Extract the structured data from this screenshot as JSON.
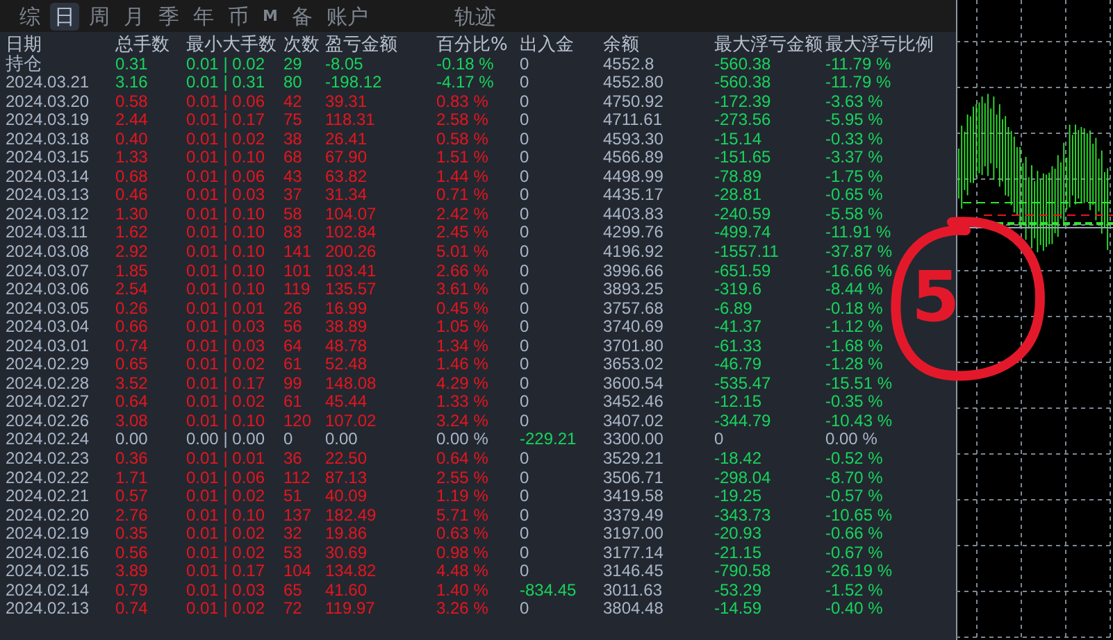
{
  "tabs": [
    {
      "label": "综",
      "selected": false
    },
    {
      "label": "日",
      "selected": true
    },
    {
      "label": "周",
      "selected": false
    },
    {
      "label": "月",
      "selected": false
    },
    {
      "label": "季",
      "selected": false
    },
    {
      "label": "年",
      "selected": false
    },
    {
      "label": "币",
      "selected": false
    },
    {
      "label": "M",
      "selected": false
    },
    {
      "label": "备",
      "selected": false
    },
    {
      "label": "账户",
      "selected": false
    }
  ],
  "track_tab": {
    "label": "轨迹",
    "selected": false
  },
  "table": {
    "columns": [
      "日期",
      "总手数",
      "最小大手数",
      "次数",
      "盈亏金额",
      "百分比%",
      "出入金",
      "余额",
      "最大浮亏金额",
      "最大浮亏比例"
    ],
    "rows": [
      {
        "date": "持仓",
        "lots": "0.31",
        "min_max": "0.01 | 0.02",
        "count": "29",
        "pnl": "-8.05",
        "pct": "-0.18 %",
        "deposit": "0",
        "deposit_moved": false,
        "balance": "4552.8",
        "max_float": "-560.38",
        "max_float_pct": "-11.79 %",
        "kind": "loss"
      },
      {
        "date": "2024.03.21",
        "lots": "3.16",
        "min_max": "0.01 | 0.31",
        "count": "80",
        "pnl": "-198.12",
        "pct": "-4.17 %",
        "deposit": "0",
        "deposit_moved": false,
        "balance": "4552.80",
        "max_float": "-560.38",
        "max_float_pct": "-11.79 %",
        "kind": "loss"
      },
      {
        "date": "2024.03.20",
        "lots": "0.58",
        "min_max": "0.01 | 0.06",
        "count": "42",
        "pnl": "39.31",
        "pct": "0.83 %",
        "deposit": "0",
        "deposit_moved": false,
        "balance": "4750.92",
        "max_float": "-172.39",
        "max_float_pct": "-3.63 %",
        "kind": "profit"
      },
      {
        "date": "2024.03.19",
        "lots": "2.44",
        "min_max": "0.01 | 0.17",
        "count": "75",
        "pnl": "118.31",
        "pct": "2.58 %",
        "deposit": "0",
        "deposit_moved": false,
        "balance": "4711.61",
        "max_float": "-273.56",
        "max_float_pct": "-5.95 %",
        "kind": "profit"
      },
      {
        "date": "2024.03.18",
        "lots": "0.40",
        "min_max": "0.01 | 0.02",
        "count": "38",
        "pnl": "26.41",
        "pct": "0.58 %",
        "deposit": "0",
        "deposit_moved": false,
        "balance": "4593.30",
        "max_float": "-15.14",
        "max_float_pct": "-0.33 %",
        "kind": "profit"
      },
      {
        "date": "2024.03.15",
        "lots": "1.33",
        "min_max": "0.01 | 0.10",
        "count": "68",
        "pnl": "67.90",
        "pct": "1.51 %",
        "deposit": "0",
        "deposit_moved": false,
        "balance": "4566.89",
        "max_float": "-151.65",
        "max_float_pct": "-3.37 %",
        "kind": "profit"
      },
      {
        "date": "2024.03.14",
        "lots": "0.68",
        "min_max": "0.01 | 0.06",
        "count": "43",
        "pnl": "63.82",
        "pct": "1.44 %",
        "deposit": "0",
        "deposit_moved": false,
        "balance": "4498.99",
        "max_float": "-78.89",
        "max_float_pct": "-1.75 %",
        "kind": "profit"
      },
      {
        "date": "2024.03.13",
        "lots": "0.46",
        "min_max": "0.01 | 0.03",
        "count": "37",
        "pnl": "31.34",
        "pct": "0.71 %",
        "deposit": "0",
        "deposit_moved": false,
        "balance": "4435.17",
        "max_float": "-28.81",
        "max_float_pct": "-0.65 %",
        "kind": "profit"
      },
      {
        "date": "2024.03.12",
        "lots": "1.30",
        "min_max": "0.01 | 0.10",
        "count": "58",
        "pnl": "104.07",
        "pct": "2.42 %",
        "deposit": "0",
        "deposit_moved": false,
        "balance": "4403.83",
        "max_float": "-240.59",
        "max_float_pct": "-5.58 %",
        "kind": "profit"
      },
      {
        "date": "2024.03.11",
        "lots": "1.62",
        "min_max": "0.01 | 0.10",
        "count": "83",
        "pnl": "102.84",
        "pct": "2.45 %",
        "deposit": "0",
        "deposit_moved": false,
        "balance": "4299.76",
        "max_float": "-499.74",
        "max_float_pct": "-11.91 %",
        "kind": "profit"
      },
      {
        "date": "2024.03.08",
        "lots": "2.92",
        "min_max": "0.01 | 0.10",
        "count": "141",
        "pnl": "200.26",
        "pct": "5.01 %",
        "deposit": "0",
        "deposit_moved": false,
        "balance": "4196.92",
        "max_float": "-1557.11",
        "max_float_pct": "-37.87 %",
        "kind": "profit"
      },
      {
        "date": "2024.03.07",
        "lots": "1.85",
        "min_max": "0.01 | 0.10",
        "count": "101",
        "pnl": "103.41",
        "pct": "2.66 %",
        "deposit": "0",
        "deposit_moved": false,
        "balance": "3996.66",
        "max_float": "-651.59",
        "max_float_pct": "-16.66 %",
        "kind": "profit"
      },
      {
        "date": "2024.03.06",
        "lots": "2.54",
        "min_max": "0.01 | 0.10",
        "count": "119",
        "pnl": "135.57",
        "pct": "3.61 %",
        "deposit": "0",
        "deposit_moved": false,
        "balance": "3893.25",
        "max_float": "-319.6",
        "max_float_pct": "-8.44 %",
        "kind": "profit"
      },
      {
        "date": "2024.03.05",
        "lots": "0.26",
        "min_max": "0.01 | 0.01",
        "count": "26",
        "pnl": "16.99",
        "pct": "0.45 %",
        "deposit": "0",
        "deposit_moved": false,
        "balance": "3757.68",
        "max_float": "-6.89",
        "max_float_pct": "-0.18 %",
        "kind": "profit"
      },
      {
        "date": "2024.03.04",
        "lots": "0.66",
        "min_max": "0.01 | 0.03",
        "count": "56",
        "pnl": "38.89",
        "pct": "1.05 %",
        "deposit": "0",
        "deposit_moved": false,
        "balance": "3740.69",
        "max_float": "-41.37",
        "max_float_pct": "-1.12 %",
        "kind": "profit"
      },
      {
        "date": "2024.03.01",
        "lots": "0.74",
        "min_max": "0.01 | 0.03",
        "count": "64",
        "pnl": "48.78",
        "pct": "1.34 %",
        "deposit": "0",
        "deposit_moved": false,
        "balance": "3701.80",
        "max_float": "-61.33",
        "max_float_pct": "-1.68 %",
        "kind": "profit"
      },
      {
        "date": "2024.02.29",
        "lots": "0.65",
        "min_max": "0.01 | 0.02",
        "count": "61",
        "pnl": "52.48",
        "pct": "1.46 %",
        "deposit": "0",
        "deposit_moved": false,
        "balance": "3653.02",
        "max_float": "-46.79",
        "max_float_pct": "-1.28 %",
        "kind": "profit"
      },
      {
        "date": "2024.02.28",
        "lots": "3.52",
        "min_max": "0.01 | 0.17",
        "count": "99",
        "pnl": "148.08",
        "pct": "4.29 %",
        "deposit": "0",
        "deposit_moved": false,
        "balance": "3600.54",
        "max_float": "-535.47",
        "max_float_pct": "-15.51 %",
        "kind": "profit"
      },
      {
        "date": "2024.02.27",
        "lots": "0.64",
        "min_max": "0.01 | 0.02",
        "count": "61",
        "pnl": "45.44",
        "pct": "1.33 %",
        "deposit": "0",
        "deposit_moved": false,
        "balance": "3452.46",
        "max_float": "-12.15",
        "max_float_pct": "-0.35 %",
        "kind": "profit"
      },
      {
        "date": "2024.02.26",
        "lots": "3.08",
        "min_max": "0.01 | 0.10",
        "count": "120",
        "pnl": "107.02",
        "pct": "3.24 %",
        "deposit": "0",
        "deposit_moved": false,
        "balance": "3407.02",
        "max_float": "-344.79",
        "max_float_pct": "-10.43 %",
        "kind": "profit"
      },
      {
        "date": "2024.02.24",
        "lots": "0.00",
        "min_max": "0.00 | 0.00",
        "count": "0",
        "pnl": "0.00",
        "pct": "0.00 %",
        "deposit": "-229.21",
        "deposit_moved": true,
        "balance": "3300.00",
        "max_float": "0",
        "max_float_pct": "0.00 %",
        "kind": "flat"
      },
      {
        "date": "2024.02.23",
        "lots": "0.36",
        "min_max": "0.01 | 0.01",
        "count": "36",
        "pnl": "22.50",
        "pct": "0.64 %",
        "deposit": "0",
        "deposit_moved": false,
        "balance": "3529.21",
        "max_float": "-18.42",
        "max_float_pct": "-0.52 %",
        "kind": "profit"
      },
      {
        "date": "2024.02.22",
        "lots": "1.71",
        "min_max": "0.01 | 0.06",
        "count": "112",
        "pnl": "87.13",
        "pct": "2.55 %",
        "deposit": "0",
        "deposit_moved": false,
        "balance": "3506.71",
        "max_float": "-298.04",
        "max_float_pct": "-8.70 %",
        "kind": "profit"
      },
      {
        "date": "2024.02.21",
        "lots": "0.57",
        "min_max": "0.01 | 0.02",
        "count": "51",
        "pnl": "40.09",
        "pct": "1.19 %",
        "deposit": "0",
        "deposit_moved": false,
        "balance": "3419.58",
        "max_float": "-19.25",
        "max_float_pct": "-0.57 %",
        "kind": "profit"
      },
      {
        "date": "2024.02.20",
        "lots": "2.76",
        "min_max": "0.01 | 0.10",
        "count": "137",
        "pnl": "182.49",
        "pct": "5.71 %",
        "deposit": "0",
        "deposit_moved": false,
        "balance": "3379.49",
        "max_float": "-343.73",
        "max_float_pct": "-10.65 %",
        "kind": "profit"
      },
      {
        "date": "2024.02.19",
        "lots": "0.35",
        "min_max": "0.01 | 0.02",
        "count": "32",
        "pnl": "19.86",
        "pct": "0.63 %",
        "deposit": "0",
        "deposit_moved": false,
        "balance": "3197.00",
        "max_float": "-20.93",
        "max_float_pct": "-0.66 %",
        "kind": "profit"
      },
      {
        "date": "2024.02.16",
        "lots": "0.56",
        "min_max": "0.01 | 0.02",
        "count": "53",
        "pnl": "30.69",
        "pct": "0.98 %",
        "deposit": "0",
        "deposit_moved": false,
        "balance": "3177.14",
        "max_float": "-21.15",
        "max_float_pct": "-0.67 %",
        "kind": "profit"
      },
      {
        "date": "2024.02.15",
        "lots": "3.89",
        "min_max": "0.01 | 0.17",
        "count": "104",
        "pnl": "134.82",
        "pct": "4.48 %",
        "deposit": "0",
        "deposit_moved": false,
        "balance": "3146.45",
        "max_float": "-790.58",
        "max_float_pct": "-26.19 %",
        "kind": "profit"
      },
      {
        "date": "2024.02.14",
        "lots": "0.79",
        "min_max": "0.01 | 0.03",
        "count": "65",
        "pnl": "41.60",
        "pct": "1.40 %",
        "deposit": "-834.45",
        "deposit_moved": true,
        "balance": "3011.63",
        "max_float": "-53.29",
        "max_float_pct": "-1.52 %",
        "kind": "profit"
      },
      {
        "date": "2024.02.13",
        "lots": "0.74",
        "min_max": "0.01 | 0.02",
        "count": "72",
        "pnl": "119.97",
        "pct": "3.26 %",
        "deposit": "0",
        "deposit_moved": false,
        "balance": "3804.48",
        "max_float": "-14.59",
        "max_float_pct": "-0.40 %",
        "kind": "profit"
      }
    ]
  },
  "annotation": {
    "text": "5"
  }
}
